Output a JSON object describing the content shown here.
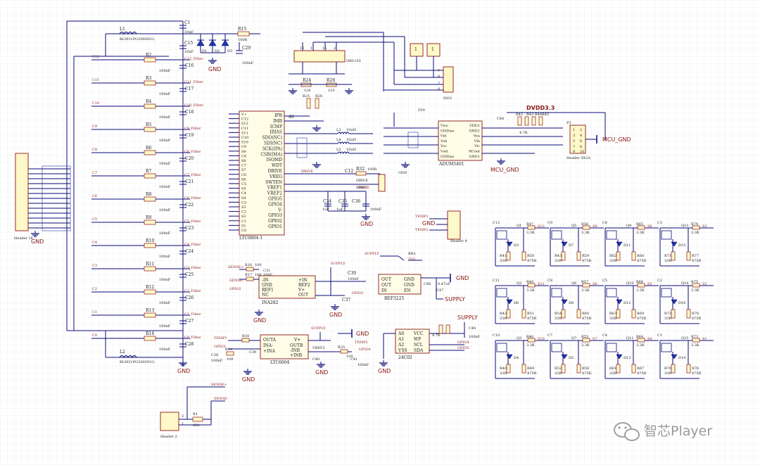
{
  "schematic": {
    "main_ic": {
      "ref": "LTC6804-1",
      "right_pins": [
        "IPB",
        "IMB",
        "ICMP",
        "IBIAS",
        "SDO(NC)",
        "SDI(NC)",
        "SCK(IPA)",
        "CSB(IMA)",
        "ISOMD",
        "WDT",
        "DRIVE",
        "VREG",
        "SWTEN",
        "VREF1",
        "VREF2",
        "GPIO5",
        "GPIO4",
        "V-",
        "GPIO3",
        "GPIO2",
        "GPIO1"
      ],
      "left_pins": [
        "V+",
        "C12",
        "S12",
        "C11",
        "S11",
        "C10",
        "S10",
        "C9",
        "S9",
        "C8",
        "S8",
        "C7",
        "S7",
        "C6",
        "S6",
        "C5",
        "S5",
        "C4",
        "S4",
        "C3",
        "S3",
        "C2",
        "S2",
        "C1",
        "S1",
        "C0"
      ],
      "pin_number": "48"
    },
    "left_header": {
      "ref": "Header 16",
      "gnd": "GND"
    },
    "cell_labels": [
      "C12",
      "C11",
      "C10",
      "C9",
      "C8",
      "C7",
      "C6",
      "C5",
      "C4",
      "C3",
      "C2",
      "C1",
      "C0"
    ],
    "filter_resistors": [
      "R2",
      "R3",
      "R4",
      "R5",
      "R6",
      "R7",
      "R8",
      "R9",
      "R10",
      "R11",
      "R12",
      "R13",
      "R14"
    ],
    "filter_res_value": "100R",
    "filter_caps": [
      "C16",
      "C17",
      "C18",
      "C19",
      "C20",
      "C21",
      "C22",
      "C23",
      "C24",
      "C25",
      "C26",
      "C27",
      "C28"
    ],
    "filter_cap_value": "100nF",
    "filter_nets": [
      "C12_Filter",
      "C11_Filter",
      "C10_Filter",
      "C9_Filter",
      "C8_Filter",
      "C7_Filter",
      "C6_Filter",
      "C5_Filter",
      "C4_Filter",
      "C3_Filter",
      "C2_Filter",
      "C1_Filter",
      "C0_Filter"
    ],
    "top_parts": {
      "c1": "C1",
      "c15": "C15",
      "l1": "L1",
      "l1_value": "BLM31PG330SN1L",
      "l2": "L2",
      "l2_value": "BLM31PG330SN1L",
      "d1": "D1",
      "d2": "D2",
      "d3": "D3",
      "r15": "R15",
      "r15_value": "100R",
      "c29": "C29",
      "c29_value": "100nF",
      "gnd": "GND",
      "cap_value": "10nF"
    },
    "header_top": {
      "ref": "HR1103",
      "pins": [
        "16",
        "1",
        "15",
        "2"
      ]
    },
    "small_headers": [
      {
        "ref": "1"
      },
      {
        "ref": "1"
      }
    ],
    "iso_header": {
      "ref": "Header 4",
      "pins": [
        "7",
        "8",
        "7",
        "8"
      ],
      "ref2": "ISO1"
    },
    "mid_parts": {
      "r24": "R24",
      "r24v": "120",
      "r28": "R28",
      "r28v": "110",
      "r25": "R25",
      "r26": "R26",
      "l3": "L3",
      "l4": "L4",
      "l5": "L5",
      "inductor_val": "10uH",
      "c32": "C32",
      "r32": "R32",
      "r32v": "100R",
      "c34": "C34",
      "c35": "C35",
      "c36": "C36",
      "c34v": "1uF",
      "c35v": "1uF",
      "c36v": "100nF",
      "c12": "C12",
      "drive": "DRIVE",
      "vreg": "VREG",
      "gnd": "GND"
    },
    "drive_header": {
      "labels": [
        "DRIVE",
        "VREG"
      ]
    },
    "isolator": {
      "ref": "ADUM5401",
      "left_pins": [
        "Viso",
        "GNDiso",
        "Vid",
        "Vob",
        "Voc",
        "Vsel",
        "GNDiso"
      ],
      "right_pins": [
        "VDD1",
        "GND1",
        "Voa",
        "Vib",
        "Vic",
        "RCout",
        "GND1"
      ]
    },
    "dvdd": {
      "label": "DVDD3.3",
      "cap": "C44",
      "r42": "R42",
      "r43": "R43",
      "r44": "R44",
      "r45": "R45",
      "res_label": "4.7K",
      "jumper": "P3",
      "jumper_label": "Header 5X2A",
      "mcu_gnd": "MCU_GND",
      "mcu_gnd_2": "MCU_GND",
      "pins": [
        "1",
        "2",
        "3",
        "4",
        "5",
        "6",
        "7",
        "8",
        "9",
        "10"
      ],
      "gnd_label": "GND",
      "vs": "5V0"
    },
    "temp_header": {
      "ref": "Header 4",
      "temp1": "TEMP1",
      "temp2": "TEMP2",
      "gnd": "GND"
    },
    "supply_sw": {
      "supply": "SUPPLY",
      "net": "5V0",
      "rx": "RR2",
      "label": "SUPPLY"
    },
    "ina282": {
      "ref": "INA282",
      "pins_left": [
        "-IN",
        "GND",
        "REF1",
        "NC"
      ],
      "pins_right": [
        "+IN",
        "REF2",
        "V+",
        "OUT"
      ],
      "sense_plus": "SENSE+",
      "sense_minus": "SENSE-",
      "r16": "R16",
      "r17": "R17",
      "rv": "100",
      "c30": "C30",
      "c31": "C31",
      "c37": "C37",
      "c30v": "100nF",
      "c31v": "10nF",
      "gpio2": "GPIO2",
      "supply": "SUPPLY",
      "gnd": "GND"
    },
    "ref_ic": {
      "ref": "REF3225",
      "pins_left": [
        "OUT",
        "OUT",
        "IN"
      ],
      "pins_right": [
        "GND",
        "GND",
        "EN"
      ],
      "c46": "C46",
      "c46v": "0.47uF",
      "c47": "C47",
      "supply": "SUPPLY",
      "gnd": "GND"
    },
    "ltc6004": {
      "ref": "LTC6004",
      "pins_left": [
        "OUTA",
        "INA-",
        "+INA"
      ],
      "pins_right": [
        "V+",
        "OUTB",
        "-INB",
        "+INB"
      ],
      "temp1": "TEMP1",
      "temp2": "TEMP2",
      "gpio4": "GPIO4",
      "gpio3": "GPIO3",
      "r18": "R18",
      "r19": "R19",
      "r35": "R35",
      "rv": "100",
      "c38": "C38",
      "c39": "C39",
      "c40": "C40",
      "c41": "C41",
      "cv": "100nF",
      "supply": "SUPPLY",
      "gnd": "GND",
      "vref2": "VREF2"
    },
    "eeprom": {
      "ref": "24C02",
      "pins_left": [
        "A0",
        "A1",
        "A2",
        "VSS"
      ],
      "pins_right": [
        "VCC",
        "WP",
        "SCL",
        "SDA"
      ],
      "r": "4.7K",
      "c": "C48",
      "cv": "100nF",
      "supply": "SUPPLY",
      "gnd": "GND",
      "gpio4": "GPIO4",
      "gpio5": "GPIO5"
    },
    "sense_header": {
      "ref": "Header 2",
      "r": "R1",
      "rv": "0R1",
      "sense_plus": "SENSE+",
      "sense_minus": "SENSE-",
      "pins": [
        "2",
        "1"
      ]
    },
    "balance_cells": [
      {
        "q": "Q1",
        "r1": "R47",
        "r1v": "3.3K",
        "d": "D3",
        "r2": "R41",
        "r3": "R50",
        "s": "S12",
        "c": "C12"
      },
      {
        "q": "Q5",
        "r1": "R56",
        "r1v": "3.3K",
        "d": "D7",
        "r2": "R43",
        "r3": "R59",
        "s": "S9",
        "c": "C9"
      },
      {
        "q": "Q9",
        "r1": "R65",
        "r1v": "3.3K",
        "d": "D11",
        "r2": "R62",
        "r3": "R68",
        "s": "S6",
        "c": "C6"
      },
      {
        "q": "Q13",
        "r1": "R74",
        "r1v": "3.3K",
        "d": "D15",
        "r2": "R71",
        "r3": "R77",
        "s": "S3",
        "c": "C3"
      },
      {
        "q": "Q2",
        "r1": "R48",
        "r1v": "3.3K",
        "d": "D6",
        "r2": "R42",
        "r3": "R51",
        "s": "S11",
        "c": "C11"
      },
      {
        "q": "Q6",
        "r1": "R57",
        "r1v": "3.3K",
        "d": "D8",
        "r2": "R54",
        "r3": "R60",
        "s": "S8",
        "c": "C8"
      },
      {
        "q": "Q10",
        "r1": "R66",
        "r1v": "3.3K",
        "d": "D12",
        "r2": "R63",
        "r3": "R69",
        "s": "S5",
        "c": "C5"
      },
      {
        "q": "Q14",
        "r1": "R75",
        "r1v": "3.3K",
        "d": "D16",
        "r2": "R72",
        "r3": "R78",
        "s": "S2",
        "c": "C2"
      },
      {
        "q": "Q3",
        "r1": "R46",
        "r1v": "3.3K",
        "d": "D4",
        "r2": "R40",
        "r3": "R49",
        "s": "S10",
        "c": "C10"
      },
      {
        "q": "Q7",
        "r1": "R55",
        "r1v": "3.3K",
        "d": "D5",
        "r2": "R52",
        "r3": "R58",
        "s": "S7",
        "c": "C7"
      },
      {
        "q": "Q11",
        "r1": "R64",
        "r1v": "3.3K",
        "d": "D13",
        "r2": "R61",
        "r3": "R67",
        "s": "S4",
        "c": "C4"
      },
      {
        "q": "Q15",
        "r1": "R73",
        "r1v": "3.3K",
        "d": "D14",
        "r2": "R70",
        "r3": "R76",
        "s": "S1",
        "c": "C1"
      }
    ],
    "balance_rvals": {
      "r2v": "33R",
      "r3v": "475R"
    }
  },
  "watermark": {
    "text": "智芯Player",
    "icon": "wechat-logo-icon"
  }
}
